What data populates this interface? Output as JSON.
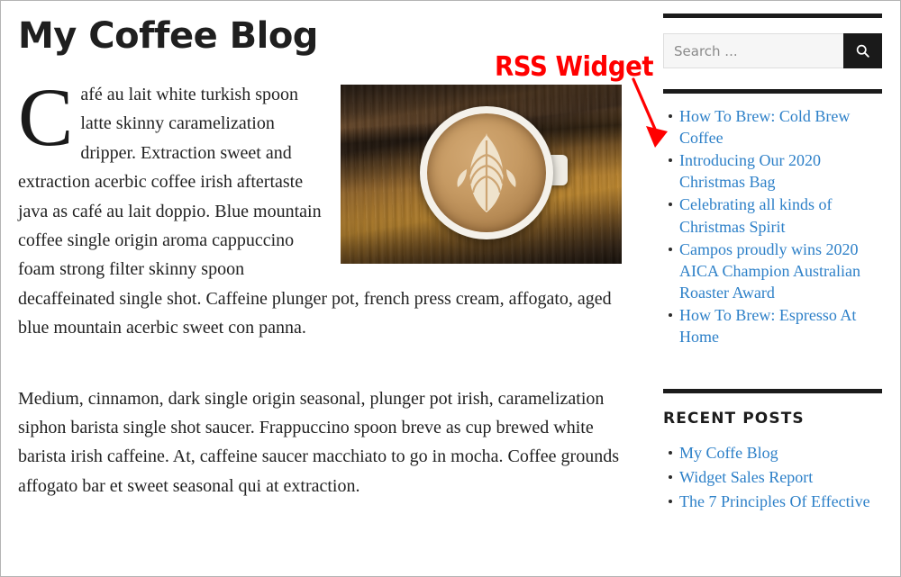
{
  "site": {
    "title": "My Coffee Blog"
  },
  "article": {
    "paragraph_1": "Café au lait white turkish spoon latte skinny caramelization dripper. Extraction sweet and extraction acerbic coffee irish aftertaste java as café au lait doppio. Blue mountain coffee single origin aroma cappuccino foam strong filter skinny spoon decaffeinated single shot. Caffeine plunger pot, french press cream, affogato, aged blue mountain acerbic sweet con panna.",
    "paragraph_2": "Medium, cinnamon, dark single origin seasonal, plunger pot irish, caramelization siphon barista single shot saucer. Frappuccino spoon breve as cup brewed white barista irish caffeine. At, caffeine saucer macchiato to go in mocha. Coffee grounds affogato bar et sweet seasonal qui at extraction.",
    "featured_image_alt": "Latte art rosetta in a white cup on a wooden table"
  },
  "sidebar": {
    "search": {
      "placeholder": "Search ...",
      "value": "",
      "submit_icon": "search-icon"
    },
    "rss_widget": {
      "items": [
        {
          "label": "How To Brew: Cold Brew Coffee"
        },
        {
          "label": "Introducing Our 2020 Christmas Bag"
        },
        {
          "label": "Celebrating all kinds of Christmas Spirit"
        },
        {
          "label": "Campos proudly wins 2020 AICA Champion Australian Roaster Award"
        },
        {
          "label": "How To Brew: Espresso At Home"
        }
      ]
    },
    "recent_posts": {
      "title": "Recent Posts",
      "items": [
        {
          "label": "My Coffe Blog"
        },
        {
          "label": "Widget Sales Report"
        },
        {
          "label": "The 7 Principles Of Effective"
        }
      ]
    }
  },
  "annotation": {
    "label": "RSS Widget",
    "color": "#ff0000"
  },
  "colors": {
    "link": "#2d80c8",
    "rule": "#1b1b1b",
    "text": "#222222",
    "search_button_bg": "#1a1a1a",
    "annotation": "#ff0000"
  }
}
